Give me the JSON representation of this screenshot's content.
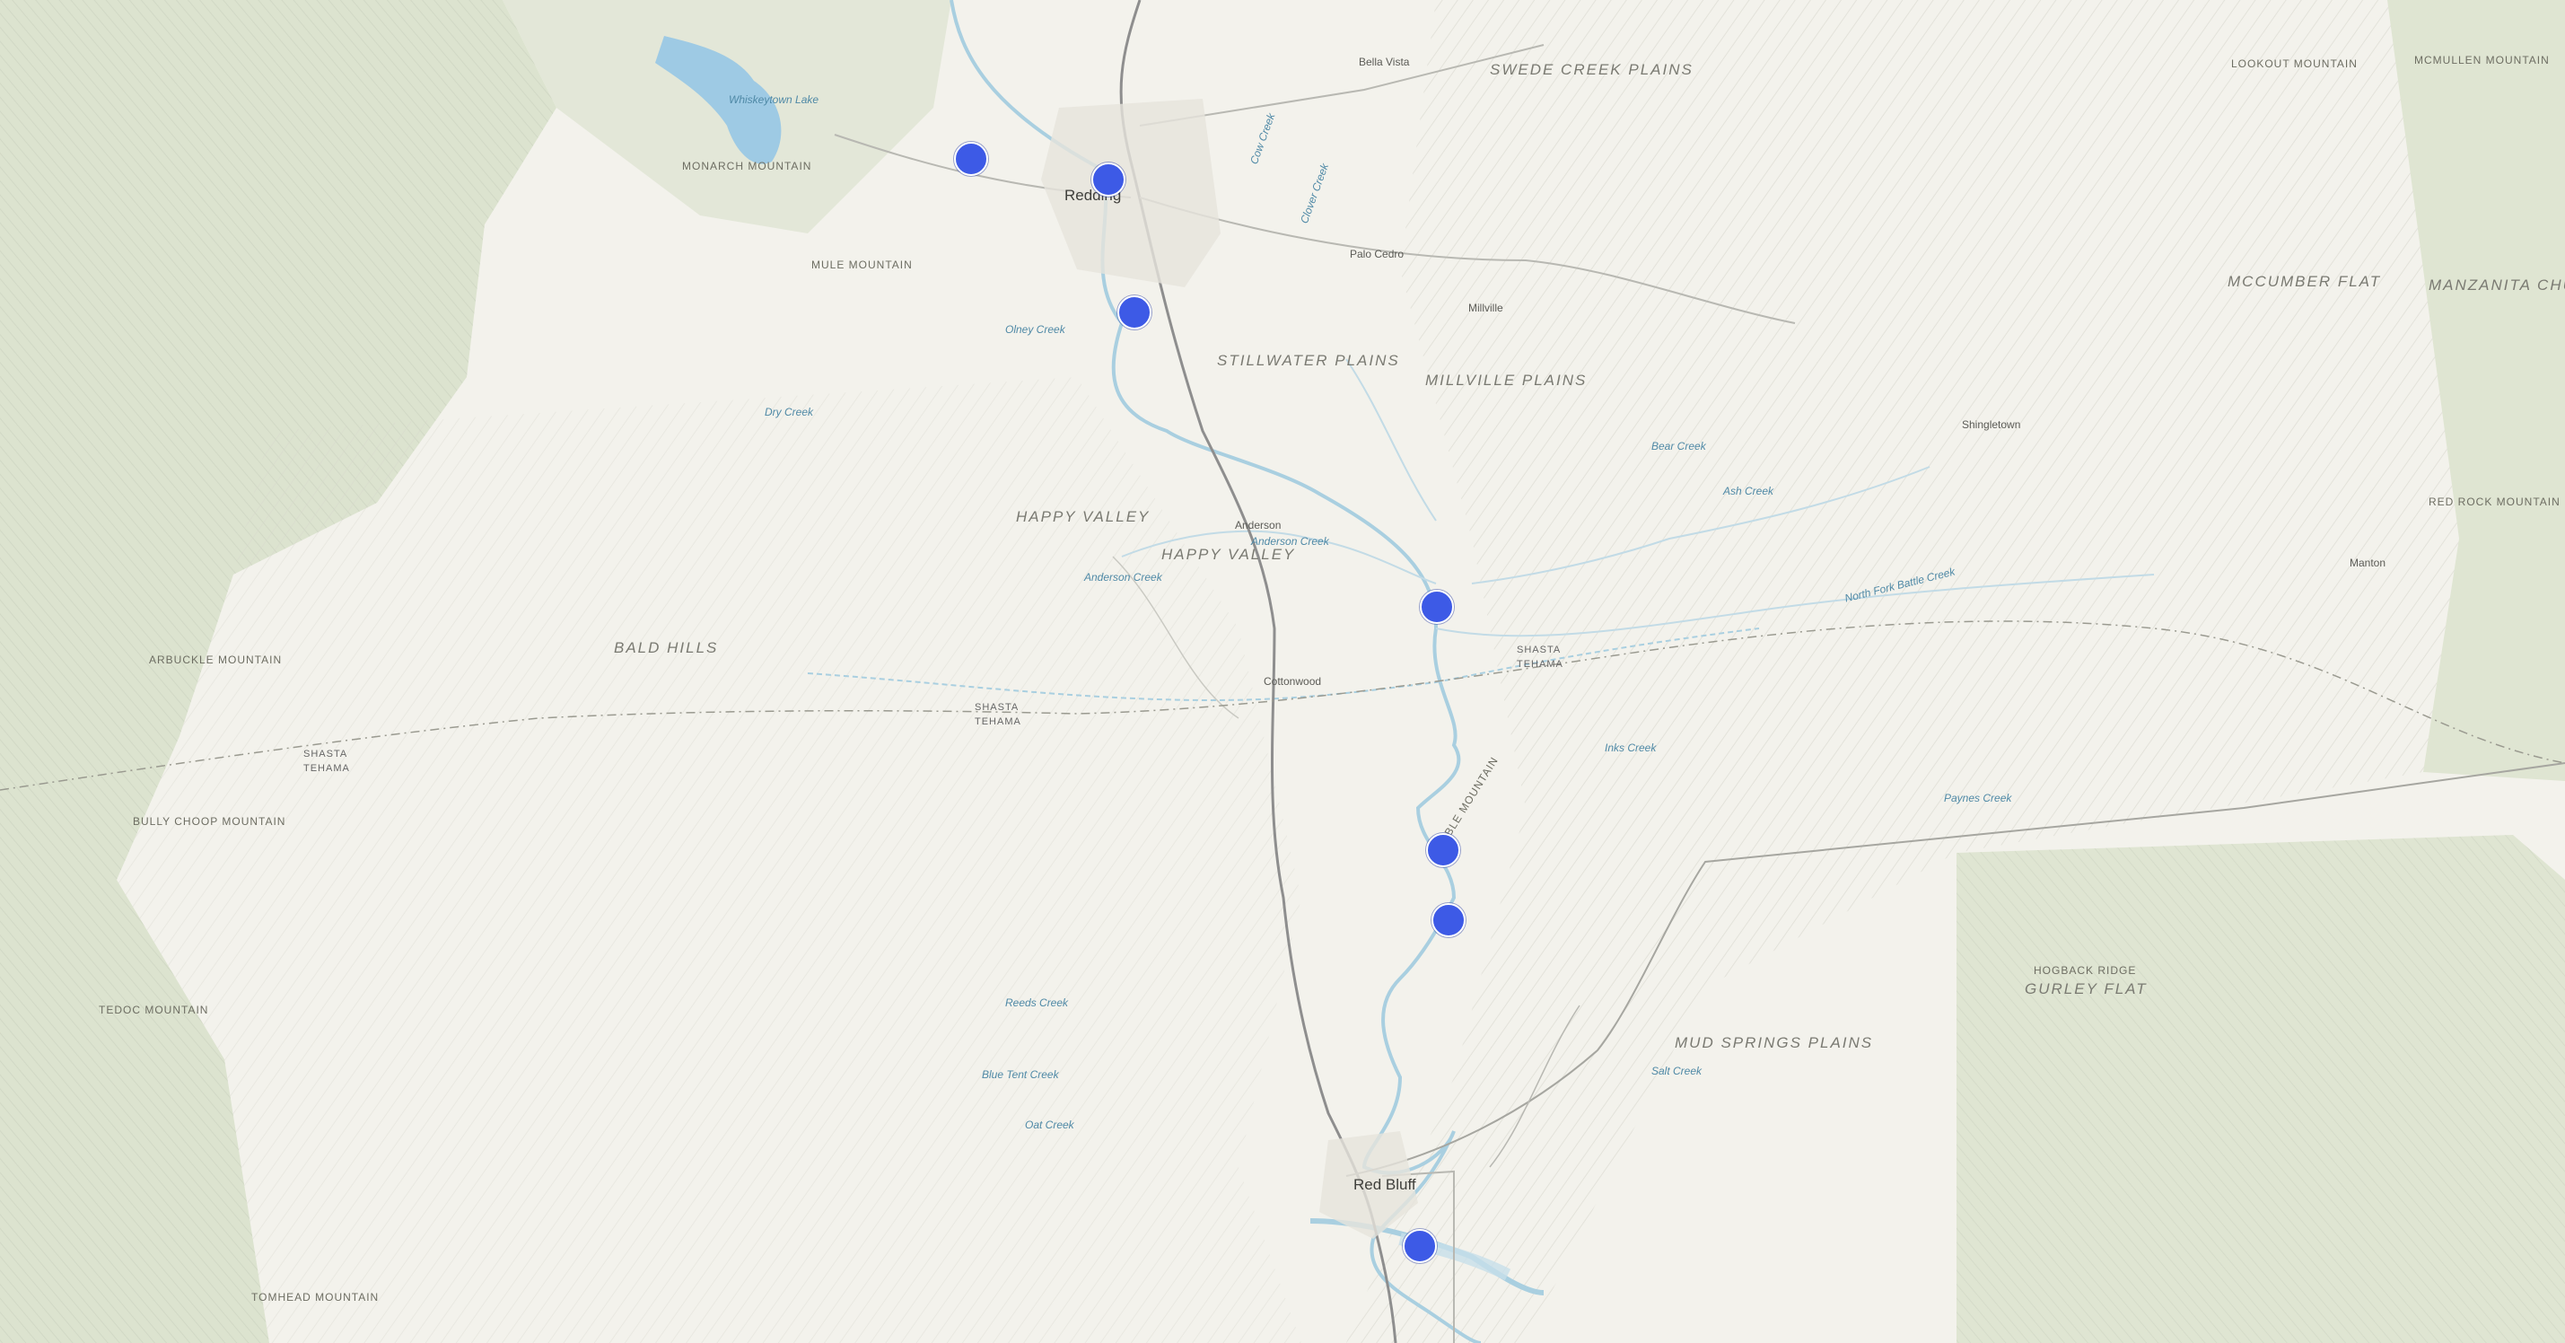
{
  "map": {
    "markers": [
      {
        "name": "marker-keswick"
      },
      {
        "name": "marker-redding"
      },
      {
        "name": "marker-south-redding"
      },
      {
        "name": "marker-cottonwood-creek"
      },
      {
        "name": "marker-bend-north"
      },
      {
        "name": "marker-bend-south"
      },
      {
        "name": "marker-red-bluff"
      }
    ],
    "labels": {
      "sweet_creek_plains": "SWEDE CREEK PLAINS",
      "stillwater_plains": "STILLWATER PLAINS",
      "millville_plains": "MILLVILLE PLAINS",
      "happy_valley": "HAPPY VALLEY",
      "happy_valley_2": "HAPPY VALLEY",
      "mud_springs_plains": "MUD SPRINGS PLAINS",
      "mccumber_flat": "MCCUMBER FLAT",
      "manzanita_chute": "MANZANITA CHUTE",
      "lookout_mountain": "LOOKOUT MOUNTAIN",
      "mcmullen_mountain": "MCMULLEN MOUNTAIN",
      "red_rock_mountain": "RED ROCK MOUNTAIN",
      "hogback_ridge": "HOGBACK RIDGE",
      "gurley_flat": "GURLEY FLAT",
      "table_mountain": "TABLE MOUNTAIN",
      "bald_hills": "BALD HILLS",
      "arbuckle_mountain": "ARBUCKLE MOUNTAIN",
      "monarch_mountain": "MONARCH MOUNTAIN",
      "mule_mountain": "MULE MOUNTAIN",
      "tedoc_mountain": "TEDOC MOUNTAIN",
      "tomhead_mountain": "TOMHEAD MOUNTAIN",
      "bully_hill_mountain": "BULLY CHOOP MOUNTAIN",
      "redding": "Redding",
      "red_bluff": "Red Bluff",
      "anderson": "Anderson",
      "cottonwood": "Cottonwood",
      "palo_cedro": "Palo Cedro",
      "millville": "Millville",
      "shingletown": "Shingletown",
      "bella_vista": "Bella Vista",
      "manton": "Manton",
      "whiskeytown_lake": "Whiskeytown Lake",
      "dry_creek": "Dry Creek",
      "anderson_creek": "Anderson Creek",
      "cow_creek": "Cow Creek",
      "bear_creek": "Bear Creek",
      "ash_creek": "Ash Creek",
      "inks_creek": "Inks Creek",
      "battle_creek": "North Fork Battle Creek",
      "paynes_creek": "Paynes Creek",
      "reeds_creek": "Reeds Creek",
      "blue_tent_creek": "Blue Tent Creek",
      "salt_creek": "Salt Creek",
      "oat_creek": "Oat Creek",
      "clover_creek": "Clover Creek",
      "olney_creek": "Olney Creek",
      "county_shasta": "SHASTA",
      "county_tehama": "TEHAMA",
      "county_shasta_2": "SHASTA",
      "county_tehama_2": "TEHAMA",
      "county_shasta_3": "SHASTA",
      "county_tehama_3": "TEHAMA"
    },
    "colors": {
      "background": "#f3f2ec",
      "forest": "#d9e2cc",
      "river": "#a9cfe0",
      "lake": "#9ecae4",
      "highway": "#8e8e8e",
      "road": "#b8b8b2",
      "marker": "#3d5ae6"
    }
  }
}
